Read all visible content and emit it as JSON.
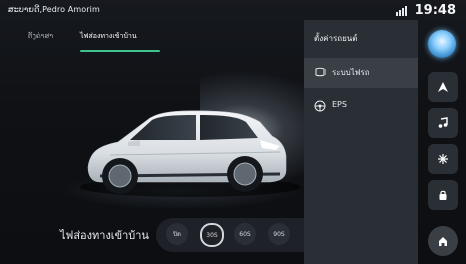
{
  "status": {
    "user_greeting": "ສະບາຍດີ,Pedro Amorim",
    "time": "19:48"
  },
  "tabs": [
    {
      "label": "ຕັ້ງຄ່າສາ"
    },
    {
      "label": "ไฟส่องทางเข้าบ้าน"
    }
  ],
  "settings_panel": {
    "title": "ตั้งค่ารถยนต์",
    "items": [
      {
        "label": "ระบบไฟรถ",
        "icon": "headlight-icon"
      },
      {
        "label": "EPS",
        "icon": "steering-wheel-icon"
      }
    ]
  },
  "home_light_control": {
    "label": "ไฟส่องทางเข้าบ้าน",
    "options": [
      "ปิด",
      "30S",
      "60S",
      "90S"
    ],
    "selected": "30S"
  },
  "dock": {
    "buttons": [
      {
        "name": "navigation-icon"
      },
      {
        "name": "music-icon"
      },
      {
        "name": "fan-icon"
      },
      {
        "name": "lock-icon"
      },
      {
        "name": "home-icon"
      }
    ]
  },
  "colors": {
    "accent": "#3ec28f",
    "panel_bg": "#2a2f35"
  }
}
